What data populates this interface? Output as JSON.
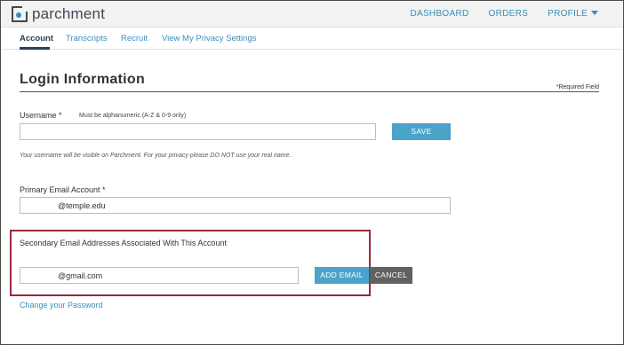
{
  "header": {
    "logo_text": "parchment",
    "nav": [
      "DASHBOARD",
      "ORDERS",
      "PROFILE"
    ]
  },
  "tabs": [
    "Account",
    "Transcripts",
    "Recruit",
    "View My Privacy Settings"
  ],
  "page": {
    "title": "Login Information",
    "required_note": "*Required Field"
  },
  "username": {
    "label": "Username *",
    "hint": "Must be alphanumeric (A-Z & 0-9 only)",
    "value": "",
    "save_label": "SAVE",
    "note": "Your username will be visible on Parchment. For your privacy please DO NOT use your real name."
  },
  "primary_email": {
    "label": "Primary Email Account *",
    "value": "@temple.edu"
  },
  "secondary_email": {
    "label": "Secondary Email Addresses Associated With This Account",
    "value": "@gmail.com",
    "add_label": "ADD EMAIL",
    "cancel_label": "CANCEL"
  },
  "change_password_label": "Change your Password",
  "colors": {
    "link": "#3b8dbd",
    "primary_button": "#4aa3c8",
    "cancel_button": "#616161",
    "highlight_border": "#9b2a3c"
  }
}
